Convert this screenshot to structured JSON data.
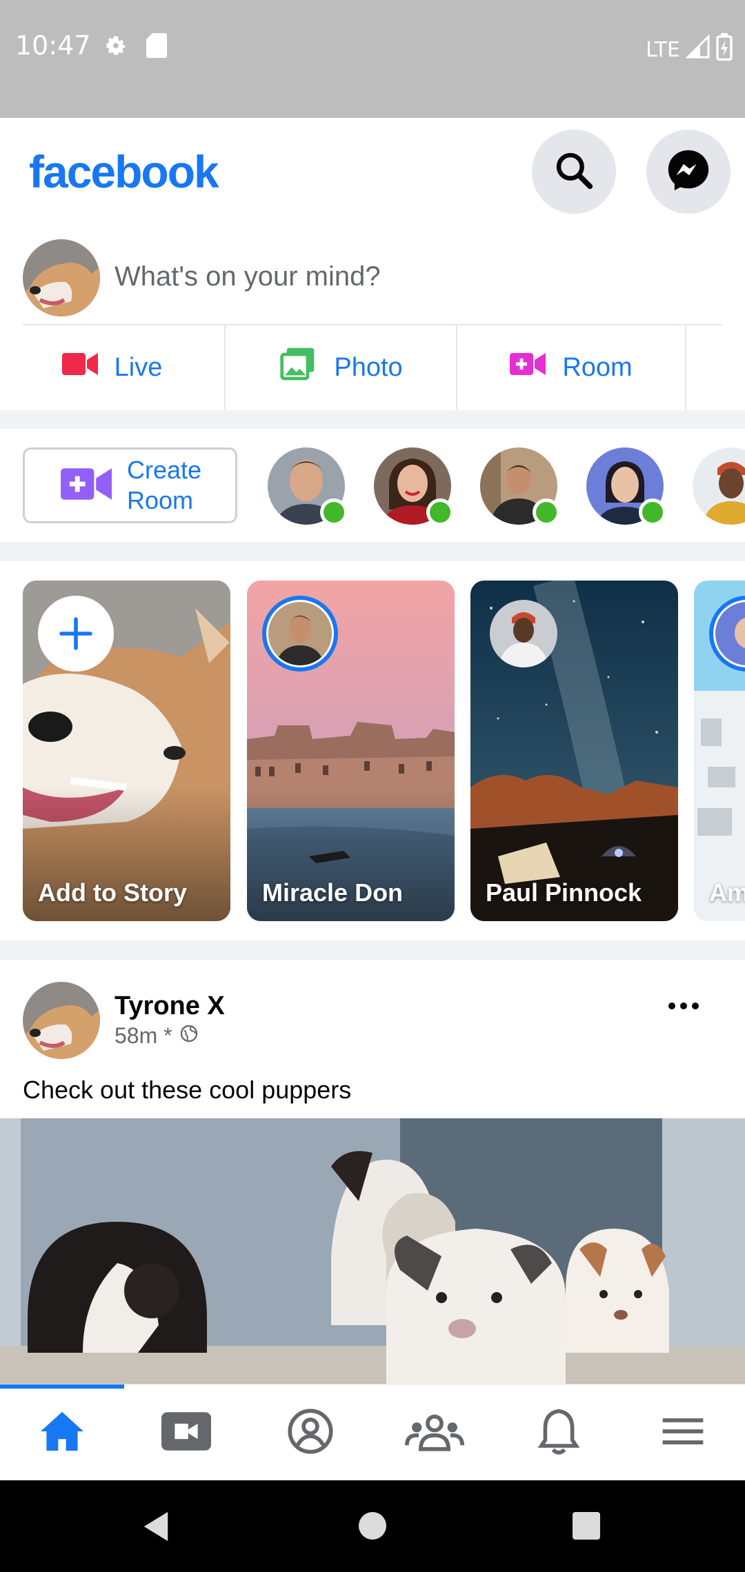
{
  "status_bar": {
    "time": "10:47",
    "network": "LTE",
    "icons": [
      "gear-icon",
      "sd-card-icon",
      "signal-icon",
      "battery-charging-icon"
    ]
  },
  "header": {
    "logo": "facebook",
    "buttons": [
      "search-icon",
      "messenger-icon"
    ]
  },
  "composer": {
    "placeholder": "What's on your mind?"
  },
  "actions": [
    {
      "label": "Live",
      "icon": "live-video-icon",
      "color": "#f02849"
    },
    {
      "label": "Photo",
      "icon": "photo-icon",
      "color": "#45bd62"
    },
    {
      "label": "Room",
      "icon": "room-icon",
      "color": "#e42fd4"
    }
  ],
  "rooms": {
    "create_label": "Create Room",
    "online_count": 5
  },
  "stories": [
    {
      "name": "Add to Story",
      "type": "create"
    },
    {
      "name": "Miracle Don",
      "type": "story"
    },
    {
      "name": "Paul Pinnock",
      "type": "story"
    },
    {
      "name": "Am",
      "type": "story"
    }
  ],
  "post": {
    "author": "Tyrone X",
    "time": "58m *",
    "text": "Check out these cool puppers"
  },
  "bottom_nav": [
    "home-icon",
    "video-icon",
    "profile-icon",
    "groups-icon",
    "notifications-icon",
    "menu-icon"
  ],
  "colors": {
    "brand": "#1877f2",
    "online": "#42b72a"
  }
}
